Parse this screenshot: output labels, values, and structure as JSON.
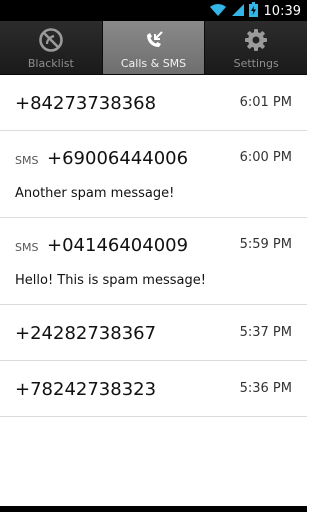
{
  "status_bar": {
    "time": "10:39",
    "icons": [
      "wifi-icon",
      "signal-icon",
      "battery-charging-icon"
    ]
  },
  "tabs": [
    {
      "label": "Blacklist",
      "icon": "blocked-icon",
      "active": false
    },
    {
      "label": "Calls & SMS",
      "icon": "incoming-call-icon",
      "active": true
    },
    {
      "label": "Settings",
      "icon": "gear-icon",
      "active": false
    }
  ],
  "entries": [
    {
      "type": "call",
      "number": "+84273738368",
      "time": "6:01 PM"
    },
    {
      "type": "sms",
      "tag": "SMS",
      "number": "+69006444006",
      "time": "6:00 PM",
      "message": "Another spam message!"
    },
    {
      "type": "sms",
      "tag": "SMS",
      "number": "+04146404009",
      "time": "5:59 PM",
      "message": "Hello! This is spam message!"
    },
    {
      "type": "call",
      "number": "+24282738367",
      "time": "5:37 PM"
    },
    {
      "type": "call",
      "number": "+78242738323",
      "time": "5:36 PM"
    }
  ],
  "colors": {
    "accent": "#33b5e5",
    "tab_active": "#7c7c7c",
    "tab_bar": "#222222"
  }
}
